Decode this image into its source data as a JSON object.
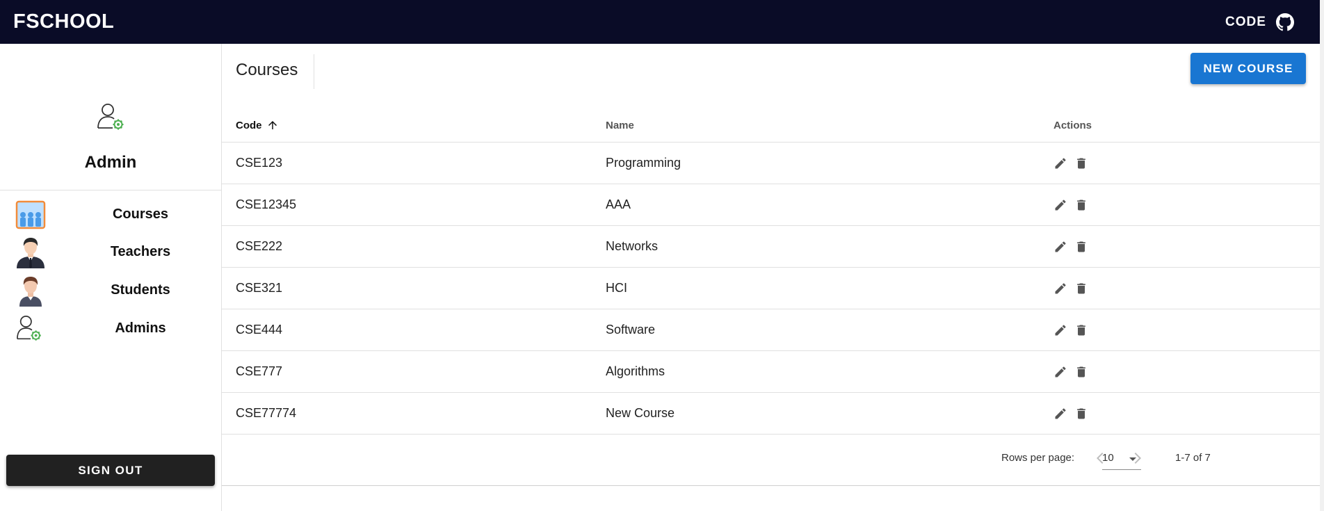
{
  "header": {
    "brand": "FSCHOOL",
    "code_label": "CODE",
    "github_icon": "github-icon"
  },
  "sidebar": {
    "profile": {
      "icon": "admin-user-gear-icon",
      "name": "Admin"
    },
    "items": [
      {
        "label": "Courses",
        "icon": "classroom-icon"
      },
      {
        "label": "Teachers",
        "icon": "teacher-avatar-icon"
      },
      {
        "label": "Students",
        "icon": "student-avatar-icon"
      },
      {
        "label": "Admins",
        "icon": "admin-user-gear-icon"
      }
    ],
    "sign_out_label": "SIGN OUT"
  },
  "main": {
    "title": "Courses",
    "new_button_label": "NEW COURSE",
    "table": {
      "columns": [
        {
          "label": "Code",
          "sorted": "ascending",
          "sort_icon": "arrow-up-icon"
        },
        {
          "label": "Name"
        },
        {
          "label": "Actions"
        }
      ],
      "rows": [
        {
          "code": "CSE123",
          "name": "Programming"
        },
        {
          "code": "CSE12345",
          "name": "AAA"
        },
        {
          "code": "CSE222",
          "name": "Networks"
        },
        {
          "code": "CSE321",
          "name": "HCI"
        },
        {
          "code": "CSE444",
          "name": "Software"
        },
        {
          "code": "CSE777",
          "name": "Algorithms"
        },
        {
          "code": "CSE77774",
          "name": "New Course"
        }
      ],
      "row_actions": [
        "edit-icon",
        "delete-icon"
      ]
    },
    "pagination": {
      "rows_per_page_label": "Rows per page:",
      "rows_per_page_value": "10",
      "range_label": "1-7 of 7"
    }
  },
  "colors": {
    "appbar": "#0a0c27",
    "primary": "#1976d2",
    "signout": "#212121"
  }
}
